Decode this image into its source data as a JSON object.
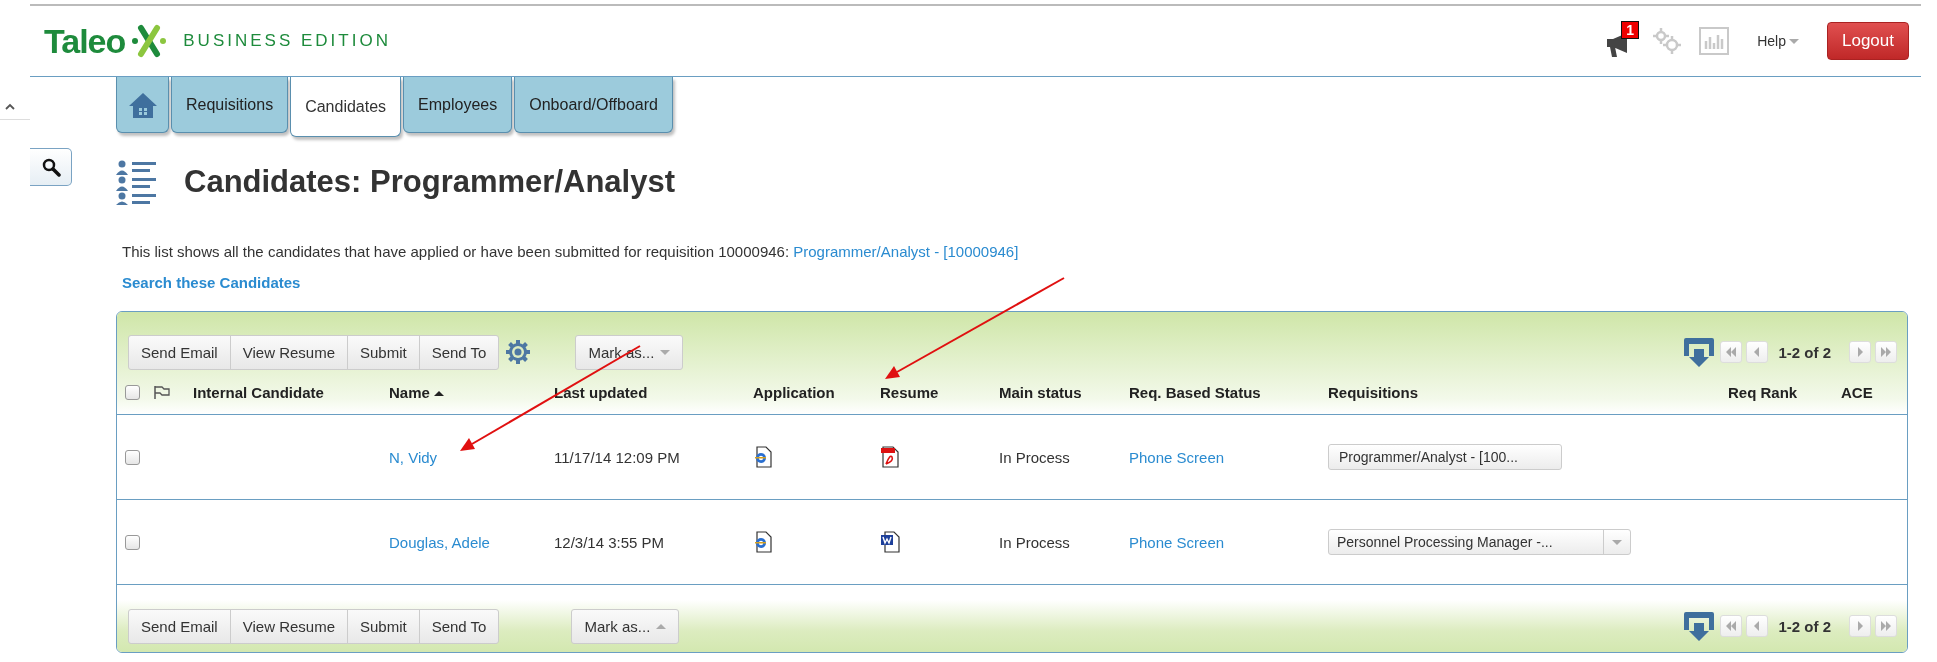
{
  "logo": {
    "name": "Taleo",
    "edition": "BUSINESS EDITION"
  },
  "header": {
    "notifications": {
      "count": "1"
    },
    "help": "Help",
    "logout": "Logout"
  },
  "tabs": [
    {
      "kind": "home",
      "selected": false
    },
    {
      "label": "Requisitions",
      "selected": false
    },
    {
      "label": "Candidates",
      "selected": true
    },
    {
      "label": "Employees",
      "selected": false
    },
    {
      "label": "Onboard/Offboard",
      "selected": false
    }
  ],
  "page": {
    "title": "Candidates: Programmer/Analyst",
    "description": "This list shows all the candidates that have applied or have been submitted for requisition 10000946:",
    "description_link": "Programmer/Analyst - [10000946]",
    "search_link": "Search these Candidates"
  },
  "toolbar": {
    "buttons": [
      "Send Email",
      "View Resume",
      "Submit",
      "Send To"
    ],
    "mark_as": "Mark as...",
    "pager": "1-2 of 2"
  },
  "table": {
    "select_all": {
      "checked": false
    },
    "columns": [
      "Internal Candidate",
      "Name",
      "Last updated",
      "Application",
      "Resume",
      "Main status",
      "Req. Based Status",
      "Requisitions",
      "Req Rank",
      "ACE"
    ],
    "sort": {
      "column_name_ascending": true
    },
    "rows": [
      {
        "checked": false,
        "name": "N, Vidy",
        "last_updated": "11/17/14 12:09 PM",
        "resume": {
          "kind": "pdf"
        },
        "main_status": "In Process",
        "req_status": "Phone Screen",
        "requisition": "Programmer/Analyst - [100...",
        "requisition_menu": false
      },
      {
        "checked": false,
        "name": "Douglas, Adele",
        "last_updated": "12/3/14 3:55 PM",
        "resume": {
          "kind": "word"
        },
        "main_status": "In Process",
        "req_status": "Phone Screen",
        "requisition": "Personnel Processing Manager -...",
        "requisition_menu": true
      }
    ]
  },
  "bottom_toolbar": {
    "buttons": [
      "Send Email",
      "View Resume",
      "Submit",
      "Send To"
    ],
    "mark_as": "Mark as...",
    "pager": "1-2 of 2"
  }
}
